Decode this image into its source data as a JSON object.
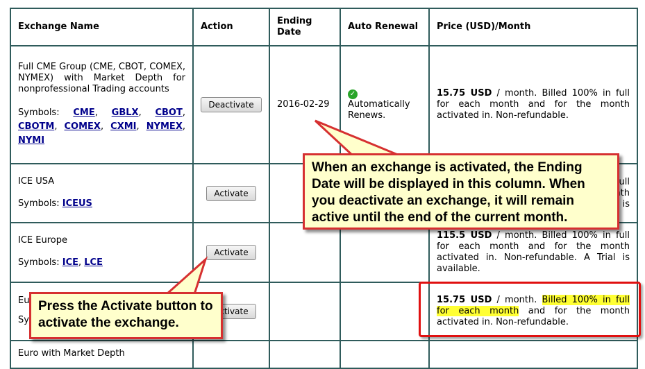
{
  "table": {
    "headers": {
      "name": "Exchange Name",
      "action": "Action",
      "ending_date": "Ending Date",
      "auto_renewal": "Auto Renewal",
      "price": "Price (USD)/Month"
    },
    "symbols_label": "Symbols:",
    "rows": [
      {
        "name": "Full CME Group (CME, CBOT, COMEX, NYMEX) with Market Depth for nonprofessional Trading accounts",
        "symbols": [
          "CME",
          "GBLX",
          "CBOT",
          "CBOTM",
          "COMEX",
          "CXMI",
          "NYMEX",
          "NYMI"
        ],
        "action": "Deactivate",
        "ending_date": "2016-02-29",
        "auto_renewal": "Automatically Renews.",
        "price_amount": "15.75 USD",
        "price_text": "/ month. Billed 100% in full for each month and for the month activated in. Non-refundable."
      },
      {
        "name": "ICE USA",
        "symbols": [
          "ICEUS"
        ],
        "action": "Activate",
        "price_partial": [
          "full",
          "month",
          "is"
        ]
      },
      {
        "name": "ICE Europe",
        "symbols": [
          "ICE",
          "LCE"
        ],
        "action": "Activate",
        "price_amount": "115.5 USD",
        "price_text": "/ month. Billed 100% in full for each month and for the month activated in. Non-refundable. A Trial is available."
      },
      {
        "name": "Eu",
        "symbols_partial": "Sy",
        "action": "Activate",
        "price_amount": "15.75 USD",
        "price_text_pre": "/ month.",
        "price_highlight_1": "Billed 100% in full",
        "price_highlight_2": "for each month",
        "price_text_post": "and for the month activated in. Non-refundable."
      },
      {
        "name": "Euro with Market Depth"
      }
    ]
  },
  "callouts": {
    "ending_date_note": "When an exchange is activated, the Ending Date will be displayed in this column. When you deactivate an exchange, it will remain active until the end of the current month.",
    "activate_note": "Press the Activate button to activate the exchange."
  },
  "colors": {
    "border": "#2f5b5b",
    "link": "#00008b",
    "callout_bg": "#ffffcc",
    "callout_border": "#d63031",
    "highlight": "#ffff33",
    "check": "#2aa52a"
  }
}
